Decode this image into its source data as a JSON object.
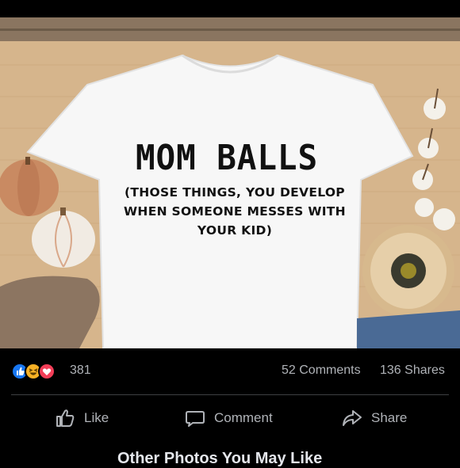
{
  "post": {
    "image": {
      "shirt_title": "MOM BALLS",
      "shirt_sub_1": "(THOSE THINGS, YOU DEVELOP",
      "shirt_sub_2": "WHEN SOMEONE MESSES WITH",
      "shirt_sub_3": "YOUR KID)"
    },
    "stats": {
      "reaction_count": "381",
      "comments": "52 Comments",
      "shares": "136 Shares",
      "reactions": [
        "like-icon",
        "haha-icon",
        "love-icon"
      ]
    },
    "actions": {
      "like_label": "Like",
      "comment_label": "Comment",
      "share_label": "Share"
    },
    "next_section_title": "Other Photos You May Like"
  },
  "colors": {
    "background": "#000000",
    "text_muted": "#b0b3b8",
    "like_blue": "#1877f2",
    "haha_yellow": "#f7b125",
    "love_red": "#f33e58"
  }
}
